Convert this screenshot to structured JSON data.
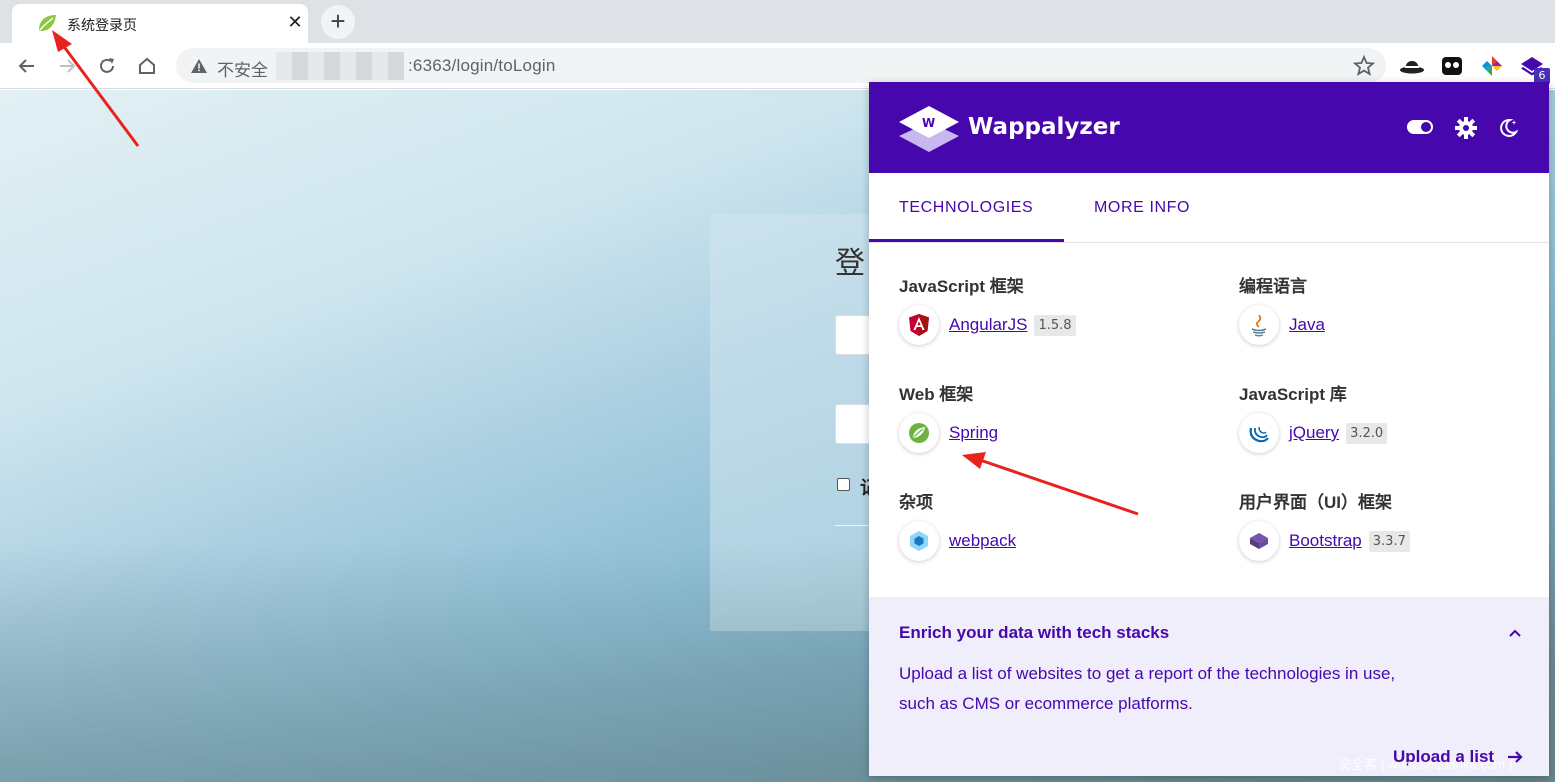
{
  "browser": {
    "tab_title": "系统登录页",
    "tab_close": "✕",
    "new_tab": "+",
    "insecure_label": "不安全",
    "url_suffix": ":6363/login/toLogin",
    "extension_badge": "6"
  },
  "login_page": {
    "title_partial": "登",
    "remember_partial": "记"
  },
  "wappalyzer": {
    "brand": "Wappalyzer",
    "tabs": [
      "TECHNOLOGIES",
      "MORE INFO"
    ],
    "categories": [
      {
        "name": "JavaScript 框架",
        "items": [
          {
            "name": "AngularJS",
            "version": "1.5.8",
            "icon": "angularjs-icon"
          }
        ]
      },
      {
        "name": "编程语言",
        "items": [
          {
            "name": "Java",
            "version": "",
            "icon": "java-icon"
          }
        ]
      },
      {
        "name": "Web 框架",
        "items": [
          {
            "name": "Spring",
            "version": "",
            "icon": "spring-icon"
          }
        ]
      },
      {
        "name": "JavaScript 库",
        "items": [
          {
            "name": "jQuery",
            "version": "3.2.0",
            "icon": "jquery-icon"
          }
        ]
      },
      {
        "name": "杂项",
        "items": [
          {
            "name": "webpack",
            "version": "",
            "icon": "webpack-icon"
          }
        ]
      },
      {
        "name": "用户界面（UI）框架",
        "items": [
          {
            "name": "Bootstrap",
            "version": "3.3.7",
            "icon": "bootstrap-icon"
          }
        ]
      }
    ],
    "footer": {
      "title": "Enrich your data with tech stacks",
      "text": "Upload a list of websites to get a report of the technologies in use, such as CMS or ecommerce platforms.",
      "link": "Upload a list"
    },
    "brand_color": "#4608ad"
  },
  "watermark": "安全客 ( www.anquanke.com )"
}
